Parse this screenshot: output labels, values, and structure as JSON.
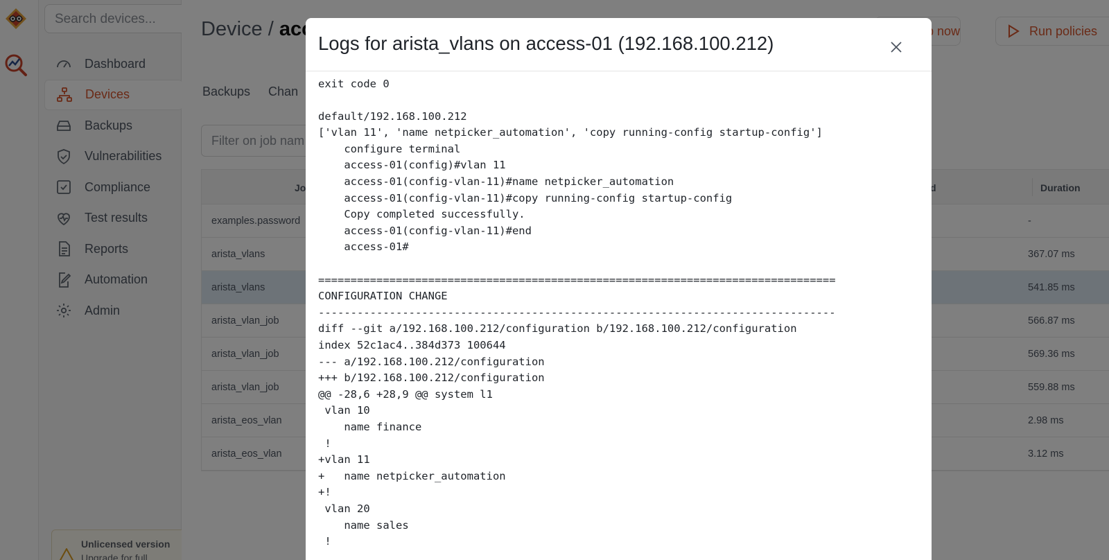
{
  "app": {
    "rail_logo_icon": "netpicker-logo-icon",
    "rail_tool_icon": "analytics-search-icon",
    "accent_color": "#d4542c"
  },
  "sidebar": {
    "search_placeholder": "Search devices...",
    "items": [
      {
        "label": "Dashboard",
        "icon": "gauge-icon",
        "active": false
      },
      {
        "label": "Devices",
        "icon": "network-icon",
        "active": true
      },
      {
        "label": "Backups",
        "icon": "hard-drive-icon",
        "active": false
      },
      {
        "label": "Vulnerabilities",
        "icon": "shield-icon",
        "active": false
      },
      {
        "label": "Compliance",
        "icon": "checkbox-icon",
        "active": false
      },
      {
        "label": "Test results",
        "icon": "heart-pulse-icon",
        "active": false
      },
      {
        "label": "Reports",
        "icon": "document-icon",
        "active": false
      },
      {
        "label": "Automation",
        "icon": "edit-document-icon",
        "active": false
      },
      {
        "label": "Admin",
        "icon": "gear-icon",
        "active": false
      }
    ],
    "license": {
      "title": "Unlicensed version",
      "subtitle": "Upgrade for full"
    }
  },
  "header": {
    "breadcrumb_root": "Device",
    "breadcrumb_sep": " / ",
    "breadcrumb_current": "acc",
    "backup_now_label": "p now",
    "run_policies_label": "Run policies"
  },
  "tabs": [
    "Backups",
    "Chan"
  ],
  "filter": {
    "placeholder": "Filter on job nam"
  },
  "table": {
    "headers": {
      "job": "Jo",
      "executed": "uted",
      "duration": "Duration"
    },
    "rows": [
      {
        "job": "examples.password",
        "duration": "-",
        "selected": false
      },
      {
        "job": "arista_vlans",
        "duration": "367.07 ms",
        "selected": false
      },
      {
        "job": "arista_vlans",
        "duration": "541.85 ms",
        "selected": true
      },
      {
        "job": "arista_vlan_job",
        "duration": "566.87 ms",
        "selected": false
      },
      {
        "job": "arista_vlan_job",
        "duration": "569.36 ms",
        "selected": false
      },
      {
        "job": "arista_vlan_job",
        "duration": "559.88 ms",
        "selected": false
      },
      {
        "job": "arista_eos_vlan",
        "duration": "2.98 ms",
        "selected": false
      },
      {
        "job": "arista_eos_vlan",
        "duration": "3.12 ms",
        "selected": false
      }
    ]
  },
  "modal": {
    "title": "Logs for arista_vlans on access-01 (192.168.100.212)",
    "close_icon": "close-icon",
    "log_lines": [
      "exit code 0",
      "",
      "default/192.168.100.212",
      "['vlan 11', 'name netpicker_automation', 'copy running-config startup-config']",
      "    configure terminal",
      "    access-01(config)#vlan 11",
      "    access-01(config-vlan-11)#name netpicker_automation",
      "    access-01(config-vlan-11)#copy running-config startup-config",
      "    Copy completed successfully.",
      "    access-01(config-vlan-11)#end",
      "    access-01#",
      "",
      "================================================================================",
      "CONFIGURATION CHANGE",
      "--------------------------------------------------------------------------------",
      "diff --git a/192.168.100.212/configuration b/192.168.100.212/configuration",
      "index 52c1ac4..384d373 100644",
      "--- a/192.168.100.212/configuration",
      "+++ b/192.168.100.212/configuration",
      "@@ -28,6 +28,9 @@ system l1",
      " vlan 10",
      "    name finance",
      " !",
      "+vlan 11",
      "+   name netpicker_automation",
      "+!",
      " vlan 20",
      "    name sales",
      " !"
    ]
  }
}
